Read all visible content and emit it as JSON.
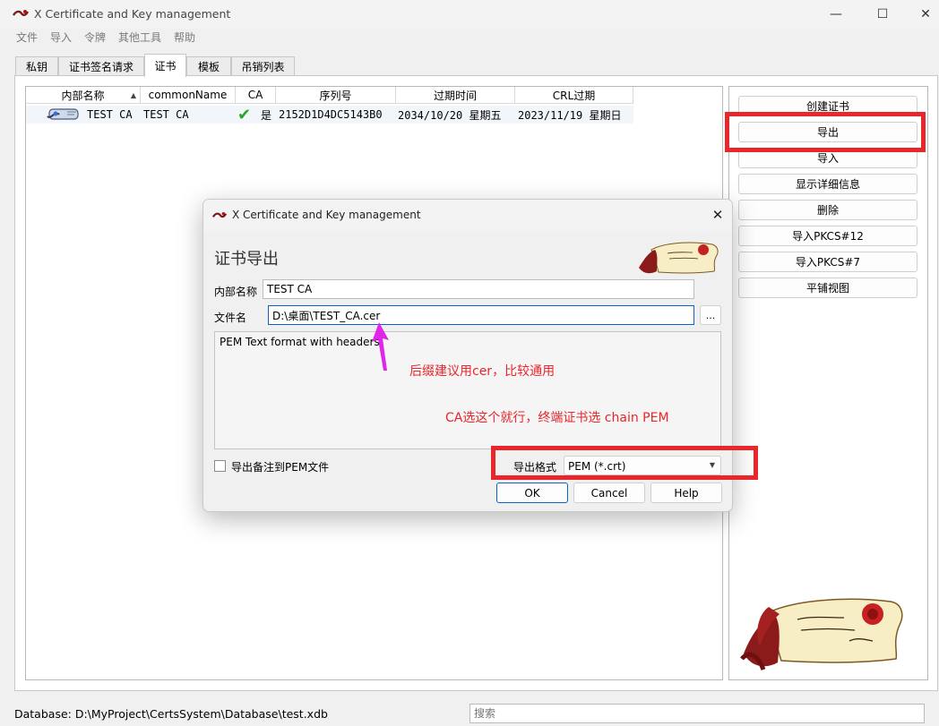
{
  "app": {
    "title": "X Certificate and Key management",
    "controls": {
      "minimize": "—",
      "maximize": "☐",
      "close": "✕"
    }
  },
  "menu": [
    "文件",
    "导入",
    "令牌",
    "其他工具",
    "帮助"
  ],
  "tabs": [
    "私钥",
    "证书签名请求",
    "证书",
    "模板",
    "吊销列表"
  ],
  "active_tab": "证书",
  "table": {
    "columns": [
      "内部名称",
      "commonName",
      "CA",
      "序列号",
      "过期时间",
      "CRL过期"
    ],
    "sort_indicator": "▲",
    "rows": [
      {
        "internal_name": "TEST CA",
        "common_name": "TEST CA",
        "ca_check": "✔",
        "ca": "是",
        "serial": "2152D1D4DC5143B0",
        "expiry": "2034/10/20 星期五",
        "crl_expiry": "2023/11/19 星期日"
      }
    ]
  },
  "side_buttons": [
    "创建证书",
    "导出",
    "导入",
    "显示详细信息",
    "删除",
    "导入PKCS#12",
    "导入PKCS#7",
    "平铺视图"
  ],
  "status": {
    "database": "Database: D:\\MyProject\\CertsSystem\\Database\\test.xdb",
    "search_placeholder": "搜索"
  },
  "dialog": {
    "title": "X Certificate and Key management",
    "close": "✕",
    "heading": "证书导出",
    "internal_name_label": "内部名称",
    "internal_name_value": "TEST CA",
    "filename_label": "文件名",
    "filename_value": "D:\\桌面\\TEST_CA.cer",
    "browse": "...",
    "format_description": "PEM Text format with headers",
    "export_comment_label": "导出备注到PEM文件",
    "export_format_label": "导出格式",
    "export_format_value": "PEM (*.crt)",
    "dropdown_arrow": "▼",
    "buttons": {
      "ok": "OK",
      "cancel": "Cancel",
      "help": "Help"
    }
  },
  "annotations": {
    "suffix_note": "后缀建议用cer，比较通用",
    "format_note": "CA选这个就行，终端证书选 chain PEM"
  },
  "colors": {
    "annotation_red": "#e8262b",
    "arrow_magenta": "#e026e8",
    "check_green": "#2aa52a",
    "focus_blue": "#0a64c8"
  }
}
